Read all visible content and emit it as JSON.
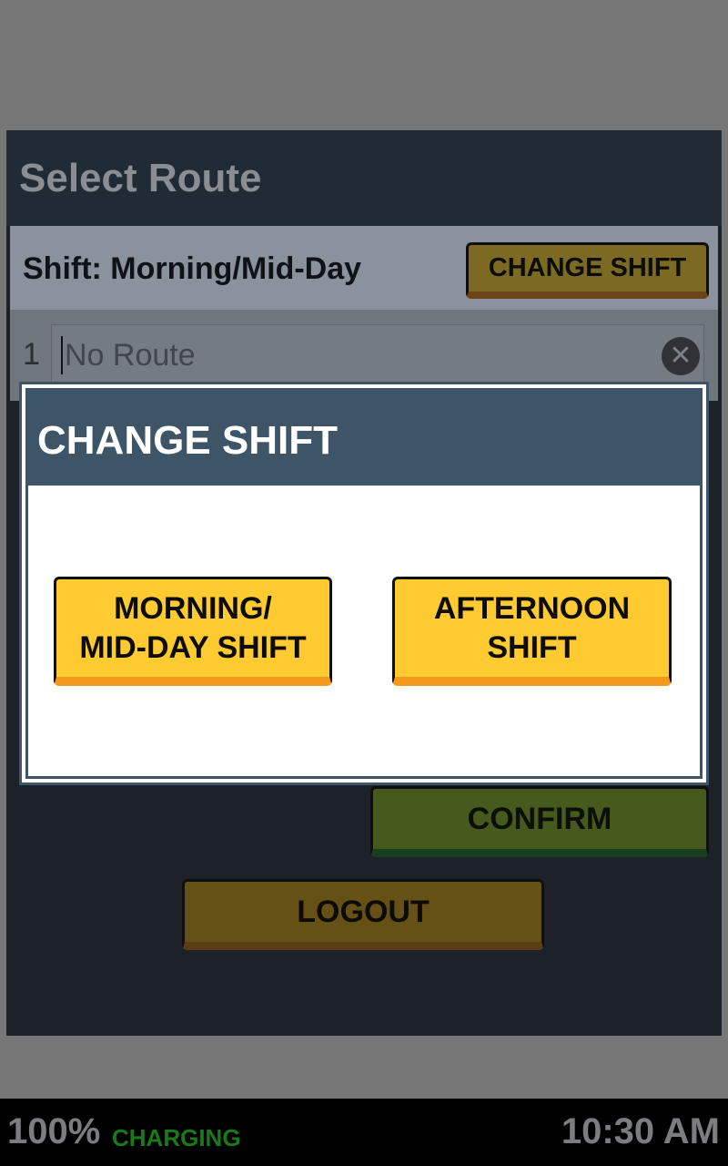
{
  "screen": {
    "title": "Select Route",
    "shift_label": "Shift: Morning/Mid-Day",
    "change_shift_button": "CHANGE SHIFT",
    "route": {
      "number": "1",
      "placeholder": "No Route",
      "value": "",
      "clear_icon": "close-circle-icon"
    },
    "confirm_button": "CONFIRM",
    "logout_button": "LOGOUT"
  },
  "dialog": {
    "title": "CHANGE SHIFT",
    "options": [
      {
        "label": "MORNING/\nMID-DAY SHIFT"
      },
      {
        "label": "AFTERNOON\nSHIFT"
      }
    ]
  },
  "status_bar": {
    "battery": "100%",
    "charging": "CHARGING",
    "time": "10:30 AM"
  },
  "colors": {
    "accent_yellow": "#ffcb30",
    "accent_orange": "#f39a1d",
    "dialog_header": "#3e5568",
    "confirm_green": "#475a1d",
    "charging_green": "#1a7a1a",
    "overlay": "#777777"
  }
}
